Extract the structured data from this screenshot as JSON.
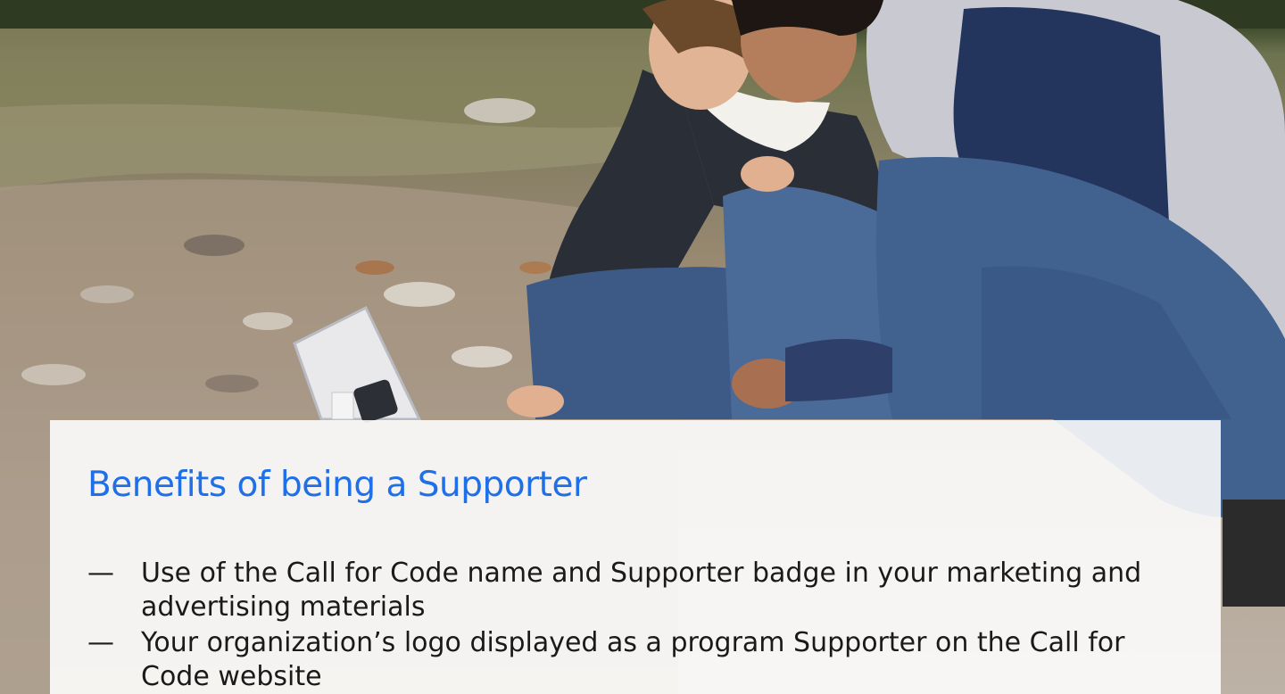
{
  "slide": {
    "title": "Benefits of being a Supporter",
    "bullet_marker": "—",
    "benefits": [
      "Use of the Call for Code name and Supporter badge in your marketing and advertising materials",
      "Your organization’s logo displayed as a program Supporter on the Call for Code website"
    ]
  },
  "colors": {
    "title": "#1f70e8",
    "body_text": "#1a1a1a",
    "card_background": "#ffffff"
  },
  "background_image": {
    "description_icon": "photo-people-river-icon"
  }
}
